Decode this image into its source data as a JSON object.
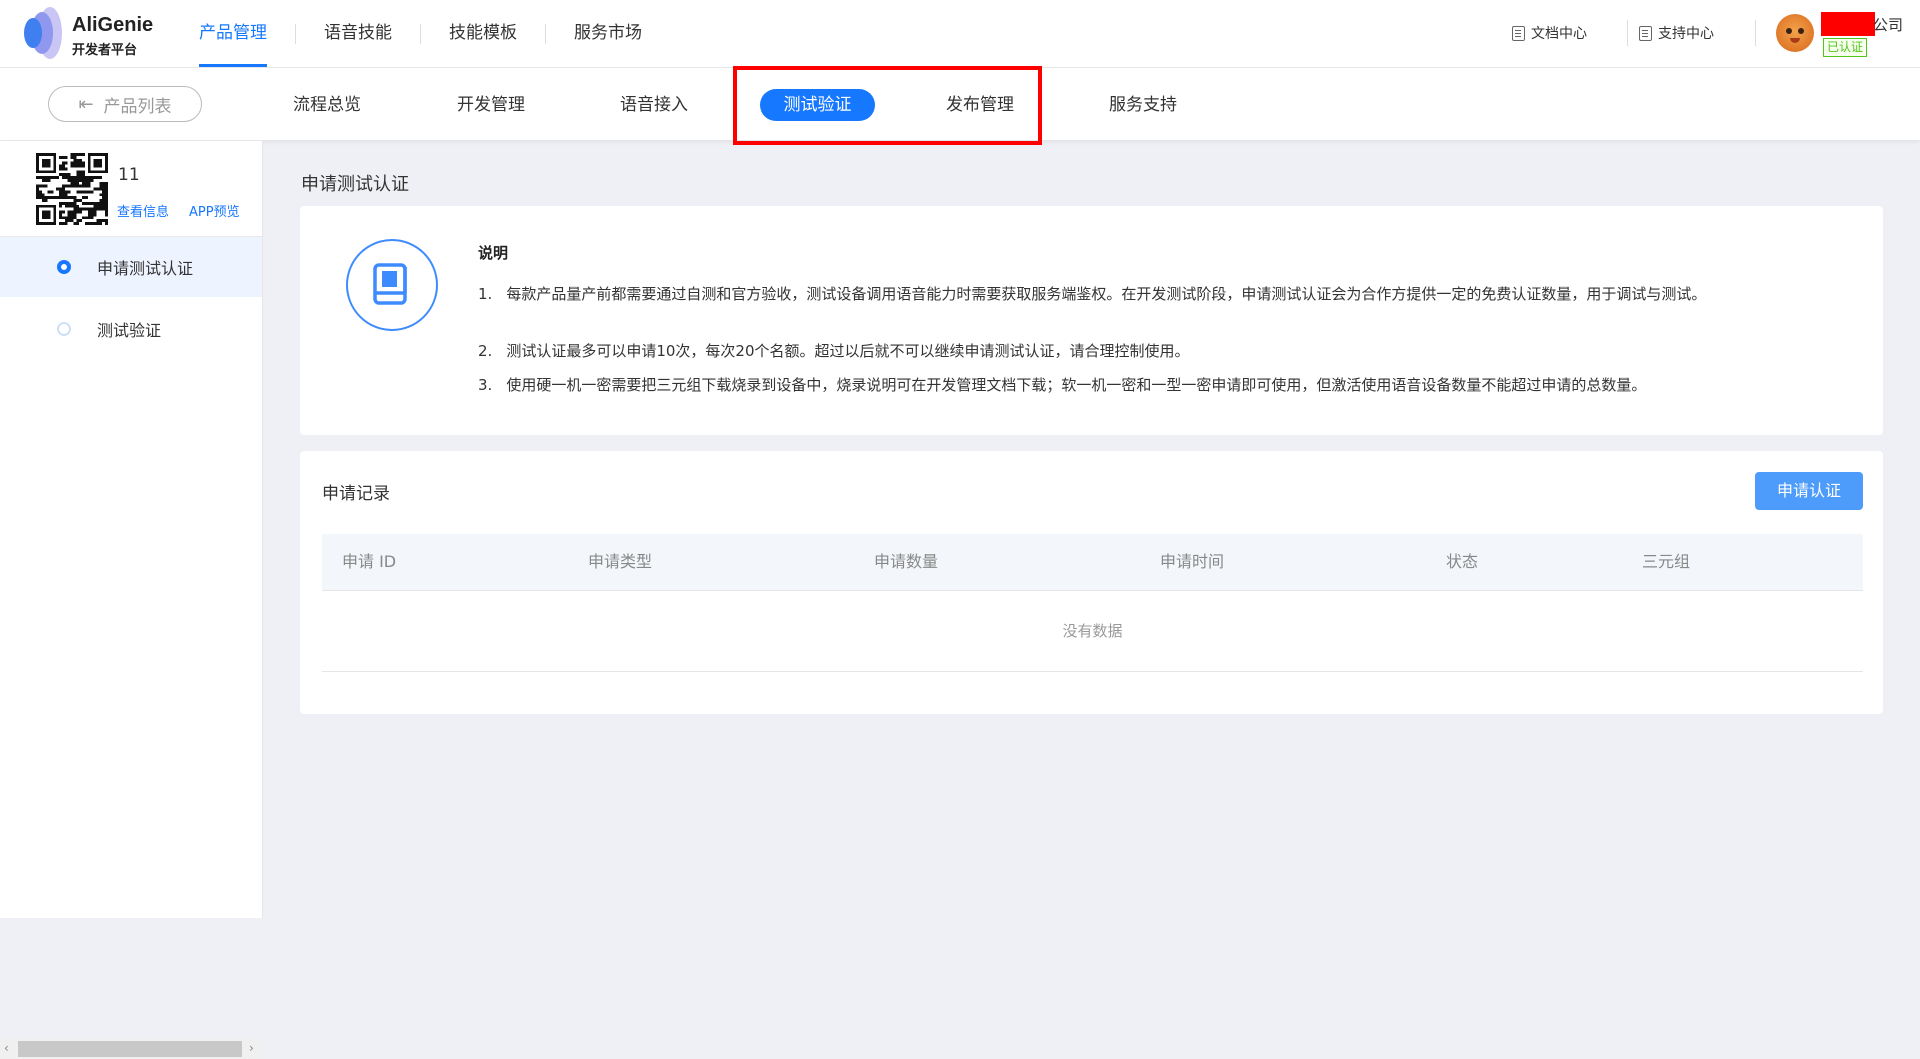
{
  "header": {
    "brand_name": "AliGenie",
    "brand_sub": "开发者平台",
    "nav": [
      {
        "label": "产品管理",
        "active": true
      },
      {
        "label": "语音技能",
        "active": false
      },
      {
        "label": "技能模板",
        "active": false
      },
      {
        "label": "服务市场",
        "active": false
      }
    ],
    "doc_center": "文档中心",
    "support_center": "支持中心",
    "company_suffix": "公司",
    "cert_badge": "已认证"
  },
  "subnav": {
    "back_label": "产品列表",
    "tabs": [
      {
        "label": "流程总览",
        "active": false
      },
      {
        "label": "开发管理",
        "active": false
      },
      {
        "label": "语音接入",
        "active": false
      },
      {
        "label": "测试验证",
        "active": true
      },
      {
        "label": "发布管理",
        "active": false
      },
      {
        "label": "服务支持",
        "active": false
      }
    ],
    "accent": "#1677ff",
    "highlight_color": "#ff0000"
  },
  "sidebar": {
    "product_name": "11",
    "view_info": "查看信息",
    "app_preview": "APP预览",
    "items": [
      {
        "label": "申请测试认证",
        "active": true
      },
      {
        "label": "测试验证",
        "active": false
      }
    ]
  },
  "main": {
    "page_title": "申请测试认证",
    "desc": {
      "icon": "book-icon",
      "title": "说明",
      "lines": [
        {
          "num": "1.",
          "text": "每款产品量产前都需要通过自测和官方验收，测试设备调用语音能力时需要获取服务端鉴权。在开发测试阶段，申请测试认证会为合作方提供一定的免费认证数量，用于调试与测试。"
        },
        {
          "num": "2.",
          "text": "测试认证最多可以申请10次，每次20个名额。超过以后就不可以继续申请测试认证，请合理控制使用。"
        },
        {
          "num": "3.",
          "text": "使用硬一机一密需要把三元组下载烧录到设备中，烧录说明可在开发管理文档下载；软一机一密和一型一密申请即可使用，但激活使用语音设备数量不能超过申请的总数量。"
        }
      ]
    },
    "records": {
      "title": "申请记录",
      "apply_button": "申请认证",
      "columns": [
        "申请 ID",
        "申请类型",
        "申请数量",
        "申请时间",
        "状态",
        "三元组"
      ],
      "empty_text": "没有数据"
    }
  }
}
